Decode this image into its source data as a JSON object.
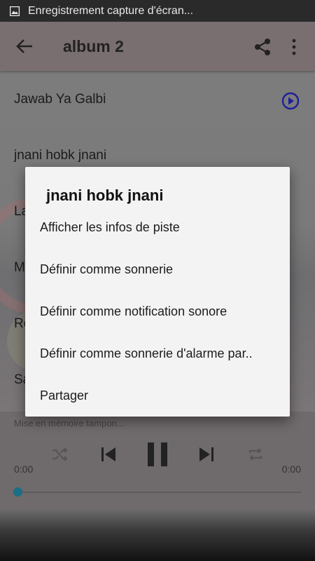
{
  "status_bar": {
    "text": "Enregistrement capture d'écran..."
  },
  "app_bar": {
    "title": "album 2"
  },
  "tracks": [
    {
      "label": "Jawab Ya Galbi"
    },
    {
      "label": "jnani hobk jnani"
    },
    {
      "label": "La"
    },
    {
      "label": "M"
    },
    {
      "label": "Ro"
    },
    {
      "label": "Sa"
    }
  ],
  "player": {
    "buffering": "Mise en mémoire tampon...",
    "time_left": "0:00",
    "time_right": "0:00",
    "progress": 0
  },
  "dialog": {
    "title": "jnani hobk jnani",
    "items": [
      {
        "label": "Afficher les infos de piste"
      },
      {
        "label": "Définir comme sonnerie"
      },
      {
        "label": "Définir comme notification sonore"
      },
      {
        "label": "Définir comme sonnerie d'alarme par.."
      },
      {
        "label": "Partager"
      }
    ]
  },
  "colors": {
    "play_icon": "#1f1f9a",
    "seek_dot": "#1a6e86"
  }
}
